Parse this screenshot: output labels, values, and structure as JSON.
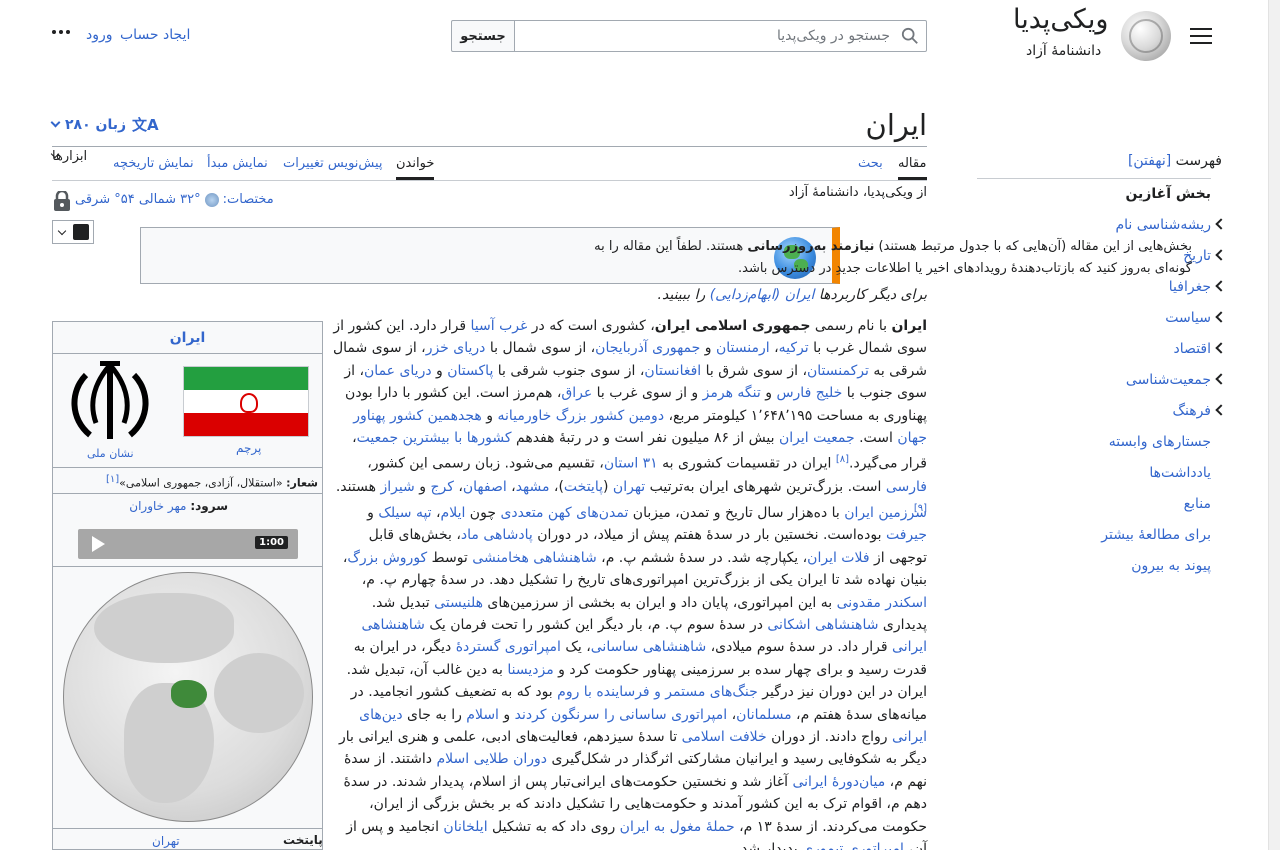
{
  "header": {
    "site_name": "ویکی‌پدیا",
    "site_tagline": "دانشنامهٔ آزاد",
    "search_placeholder": "جستجو در ویکی‌پدیا",
    "search_button": "جستجو",
    "login": "ورود",
    "create_account": "ایجاد حساب"
  },
  "page": {
    "title": "ایران",
    "languages": "۲۸۰ زبان",
    "from": "از ویکی‌پدیا، دانشنامهٔ آزاد",
    "coords_label": "مختصات:",
    "coords_value": "۳۲° شمالی ۵۴° شرقی"
  },
  "tabs": {
    "article": "مقاله",
    "talk": "بحث",
    "read": "خواندن",
    "edit_preview": "پیش‌نویس تغییرات",
    "view_source": "نمایش مبدأ",
    "history": "نمایش تاریخچه",
    "tools": "ابزارها"
  },
  "toc": {
    "heading": "فهرست",
    "hide": "[نهفتن]",
    "items": [
      {
        "label": "بخش آغازین",
        "bold": true
      },
      {
        "label": "ریشه‌شناسی نام"
      },
      {
        "label": "تاریخ"
      },
      {
        "label": "جغرافیا"
      },
      {
        "label": "سیاست"
      },
      {
        "label": "اقتصاد"
      },
      {
        "label": "جمعیت‌شناسی"
      },
      {
        "label": "فرهنگ"
      },
      {
        "label": "جستارهای وابسته"
      },
      {
        "label": "یادداشت‌ها"
      },
      {
        "label": "منابع"
      },
      {
        "label": "برای مطالعهٔ بیشتر"
      },
      {
        "label": "پیوند به بیرون"
      }
    ]
  },
  "notice": {
    "text_a": "بخش‌هایی از این مقاله (آن‌هایی که با جدول مرتبط هستند) ",
    "text_bold": "نیازمند به‌روزرسانی",
    "text_b": " هستند. لطفاً این مقاله را به گونه‌ای به‌روز کنید که بازتاب‌دهندهٔ رویدادهای اخیر یا اطلاعات جدیدِ در دسترس باشد."
  },
  "hatnote": {
    "pre": "برای دیگر کاربردها ",
    "link": "ایران (ابهام‌زدایی)",
    "post": " را ببینید."
  },
  "infobox": {
    "title": "ایران",
    "flag_caption": "پرچم",
    "emblem_caption": "نشان ملی",
    "motto_label": "شعار:",
    "motto_value": "«استقلال، آزادی، جمهوری اسلامی»",
    "motto_ref": "[۱]",
    "anthem_label": "سرود:",
    "anthem_value": "مهر خاوران",
    "audio_time": "1:00",
    "capital_label": "پایتخت",
    "capital_value": "تهران"
  },
  "colors": {
    "link": "#3366cc",
    "notice_bar": "#f28500",
    "flag_green": "#239f40",
    "flag_red": "#da0000"
  }
}
